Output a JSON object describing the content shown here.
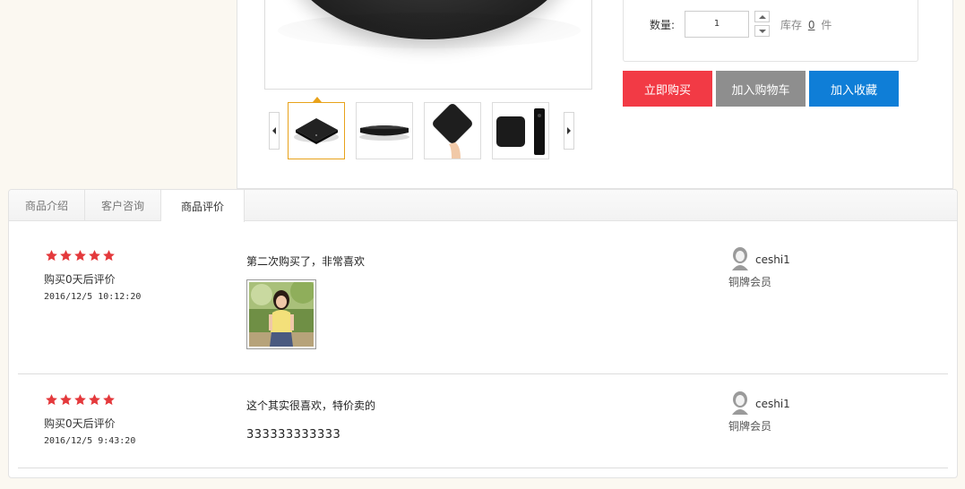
{
  "purchase": {
    "qty_label": "数量:",
    "qty_value": "1",
    "stock_prefix": "库存",
    "stock_count": "0",
    "stock_unit": "件",
    "buy_now": "立即购买",
    "add_cart": "加入购物车",
    "add_favorite": "加入收藏",
    "colors": {
      "buy": "#f23a45",
      "cart": "#8e8e8e",
      "favorite": "#0f7ed7"
    }
  },
  "gallery": {
    "thumbnails": [
      "product-front",
      "product-side",
      "product-in-hand",
      "product-with-remote"
    ],
    "active_index": 0
  },
  "tabs": [
    {
      "label": "商品介绍",
      "active": false
    },
    {
      "label": "客户咨询",
      "active": false
    },
    {
      "label": "商品评价",
      "active": true
    }
  ],
  "reviews": [
    {
      "rating": 5,
      "days_text": "购买0天后评价",
      "date": "2016/12/5 10:12:20",
      "content": "第二次购买了，非常喜欢",
      "has_photo": true,
      "user": "ceshi1",
      "level": "铜牌会员"
    },
    {
      "rating": 5,
      "days_text": "购买0天后评价",
      "date": "2016/12/5 9:43:20",
      "content": "这个其实很喜欢，特价卖的",
      "extra": "333333333333",
      "has_photo": false,
      "user": "ceshi1",
      "level": "铜牌会员"
    }
  ]
}
